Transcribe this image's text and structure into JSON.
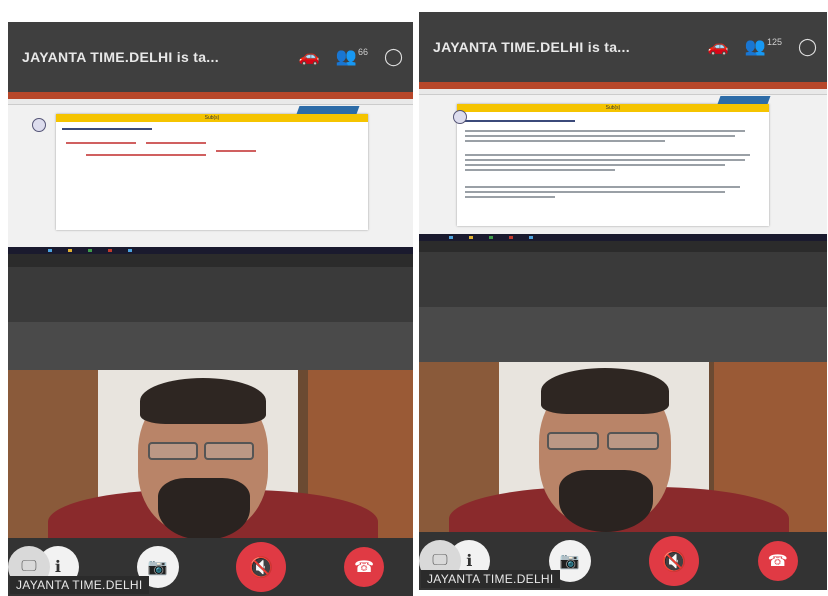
{
  "left": {
    "title": "JAYANTA TIME.DELHI is ta...",
    "participants_count": "66",
    "slide_title": "Sub(s)",
    "presenter_name": "JAYANTA TIME.DELHI"
  },
  "right": {
    "title": "JAYANTA TIME.DELHI is ta...",
    "participants_count": "125",
    "slide_title": "Sub(s)",
    "presenter_name": "JAYANTA TIME.DELHI"
  },
  "icons": {
    "car": "car-icon",
    "participants": "participants-icon",
    "chat": "chat-icon",
    "info": "info-icon",
    "video_off": "video-off-icon",
    "mic_off": "mic-off-icon",
    "share_screen": "share-screen-icon",
    "leave": "leave-call-icon"
  },
  "colors": {
    "topbar": "#3f3f3f",
    "danger": "#e03a44",
    "slide_header": "#f5c400"
  }
}
